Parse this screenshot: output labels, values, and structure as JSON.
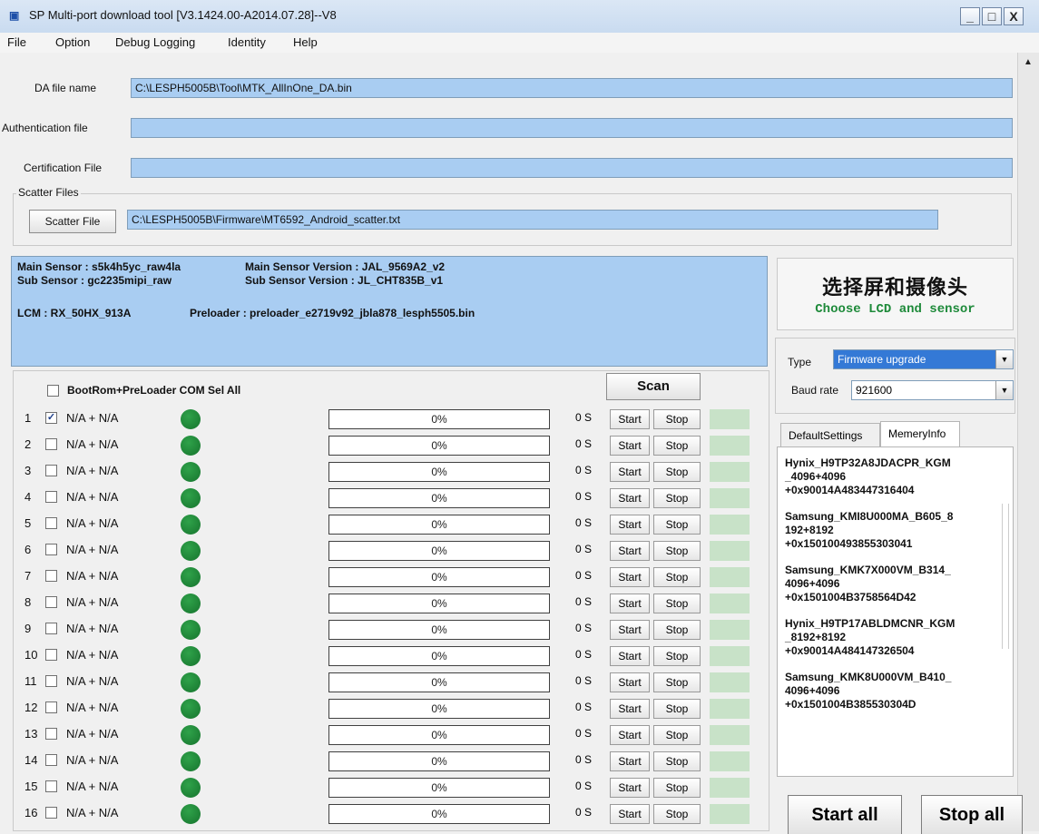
{
  "window": {
    "title": "SP Multi-port download tool [V3.1424.00-A2014.07.28]--V8",
    "controls": [
      "_",
      "□",
      "X"
    ]
  },
  "menu": [
    "File",
    "Option",
    "Debug Logging",
    "Identity",
    "Help"
  ],
  "files": {
    "da_label": "DA file name",
    "da_value": "C:\\LESPH5005B\\Tool\\MTK_AllInOne_DA.bin",
    "auth_label": "Authentication file",
    "auth_value": "",
    "cert_label": "Certification File",
    "cert_value": "",
    "scatter_group": "Scatter Files",
    "scatter_button": "Scatter File",
    "scatter_value": "C:\\LESPH5005B\\Firmware\\MT6592_Android_scatter.txt"
  },
  "info": {
    "main_sensor": "Main Sensor : s5k4h5yc_raw4la",
    "main_sensor_version": "Main Sensor Version : JAL_9569A2_v2",
    "sub_sensor": "Sub Sensor : gc2235mipi_raw",
    "sub_sensor_version": "Sub Sensor Version : JL_CHT835B_v1",
    "lcm": "LCM : RX_50HX_913A",
    "preloader": "Preloader : preloader_e2719v92_jbla878_lesph5505.bin"
  },
  "promo": {
    "chinese": "选择屏和摄像头",
    "english": "Choose LCD and sensor"
  },
  "controls": {
    "type_label": "Type",
    "type_value": "Firmware upgrade",
    "baud_label": "Baud rate",
    "baud_value": "921600"
  },
  "tabs": [
    "DefaultSettings",
    "MemeryInfo"
  ],
  "memory_info": [
    "Hynix_H9TP32A8JDACPR_KGM\n_4096+4096\n+0x90014A483447316404",
    "Samsung_KMI8U000MA_B605_8\n192+8192\n+0x150100493855303041",
    "Samsung_KMK7X000VM_B314_\n4096+4096\n+0x1501004B3758564D42",
    "Hynix_H9TP17ABLDMCNR_KGM\n_8192+8192\n+0x90014A484147326504",
    "Samsung_KMK8U000VM_B410_\n4096+4096\n+0x1501004B385530304D"
  ],
  "ports": {
    "sel_all_label": "BootRom+PreLoader COM Sel All",
    "scan_button": "Scan",
    "start_label": "Start",
    "stop_label": "Stop",
    "rows": [
      {
        "num": "1",
        "checked": true,
        "name": "N/A + N/A",
        "progress": "0%",
        "time": "0 S"
      },
      {
        "num": "2",
        "checked": false,
        "name": "N/A + N/A",
        "progress": "0%",
        "time": "0 S"
      },
      {
        "num": "3",
        "checked": false,
        "name": "N/A + N/A",
        "progress": "0%",
        "time": "0 S"
      },
      {
        "num": "4",
        "checked": false,
        "name": "N/A + N/A",
        "progress": "0%",
        "time": "0 S"
      },
      {
        "num": "5",
        "checked": false,
        "name": "N/A + N/A",
        "progress": "0%",
        "time": "0 S"
      },
      {
        "num": "6",
        "checked": false,
        "name": "N/A + N/A",
        "progress": "0%",
        "time": "0 S"
      },
      {
        "num": "7",
        "checked": false,
        "name": "N/A + N/A",
        "progress": "0%",
        "time": "0 S"
      },
      {
        "num": "8",
        "checked": false,
        "name": "N/A + N/A",
        "progress": "0%",
        "time": "0 S"
      },
      {
        "num": "9",
        "checked": false,
        "name": "N/A + N/A",
        "progress": "0%",
        "time": "0 S"
      },
      {
        "num": "10",
        "checked": false,
        "name": "N/A + N/A",
        "progress": "0%",
        "time": "0 S"
      },
      {
        "num": "11",
        "checked": false,
        "name": "N/A + N/A",
        "progress": "0%",
        "time": "0 S"
      },
      {
        "num": "12",
        "checked": false,
        "name": "N/A + N/A",
        "progress": "0%",
        "time": "0 S"
      },
      {
        "num": "13",
        "checked": false,
        "name": "N/A + N/A",
        "progress": "0%",
        "time": "0 S"
      },
      {
        "num": "14",
        "checked": false,
        "name": "N/A + N/A",
        "progress": "0%",
        "time": "0 S"
      },
      {
        "num": "15",
        "checked": false,
        "name": "N/A + N/A",
        "progress": "0%",
        "time": "0 S"
      },
      {
        "num": "16",
        "checked": false,
        "name": "N/A + N/A",
        "progress": "0%",
        "time": "0 S"
      }
    ]
  },
  "actions": {
    "start_all": "Start all",
    "stop_all": "Stop all"
  },
  "colors": {
    "field_blue": "#a9cdf2",
    "led_green": "#16742d",
    "status_green": "#c8e2c8",
    "select_highlight": "#3479d6"
  }
}
